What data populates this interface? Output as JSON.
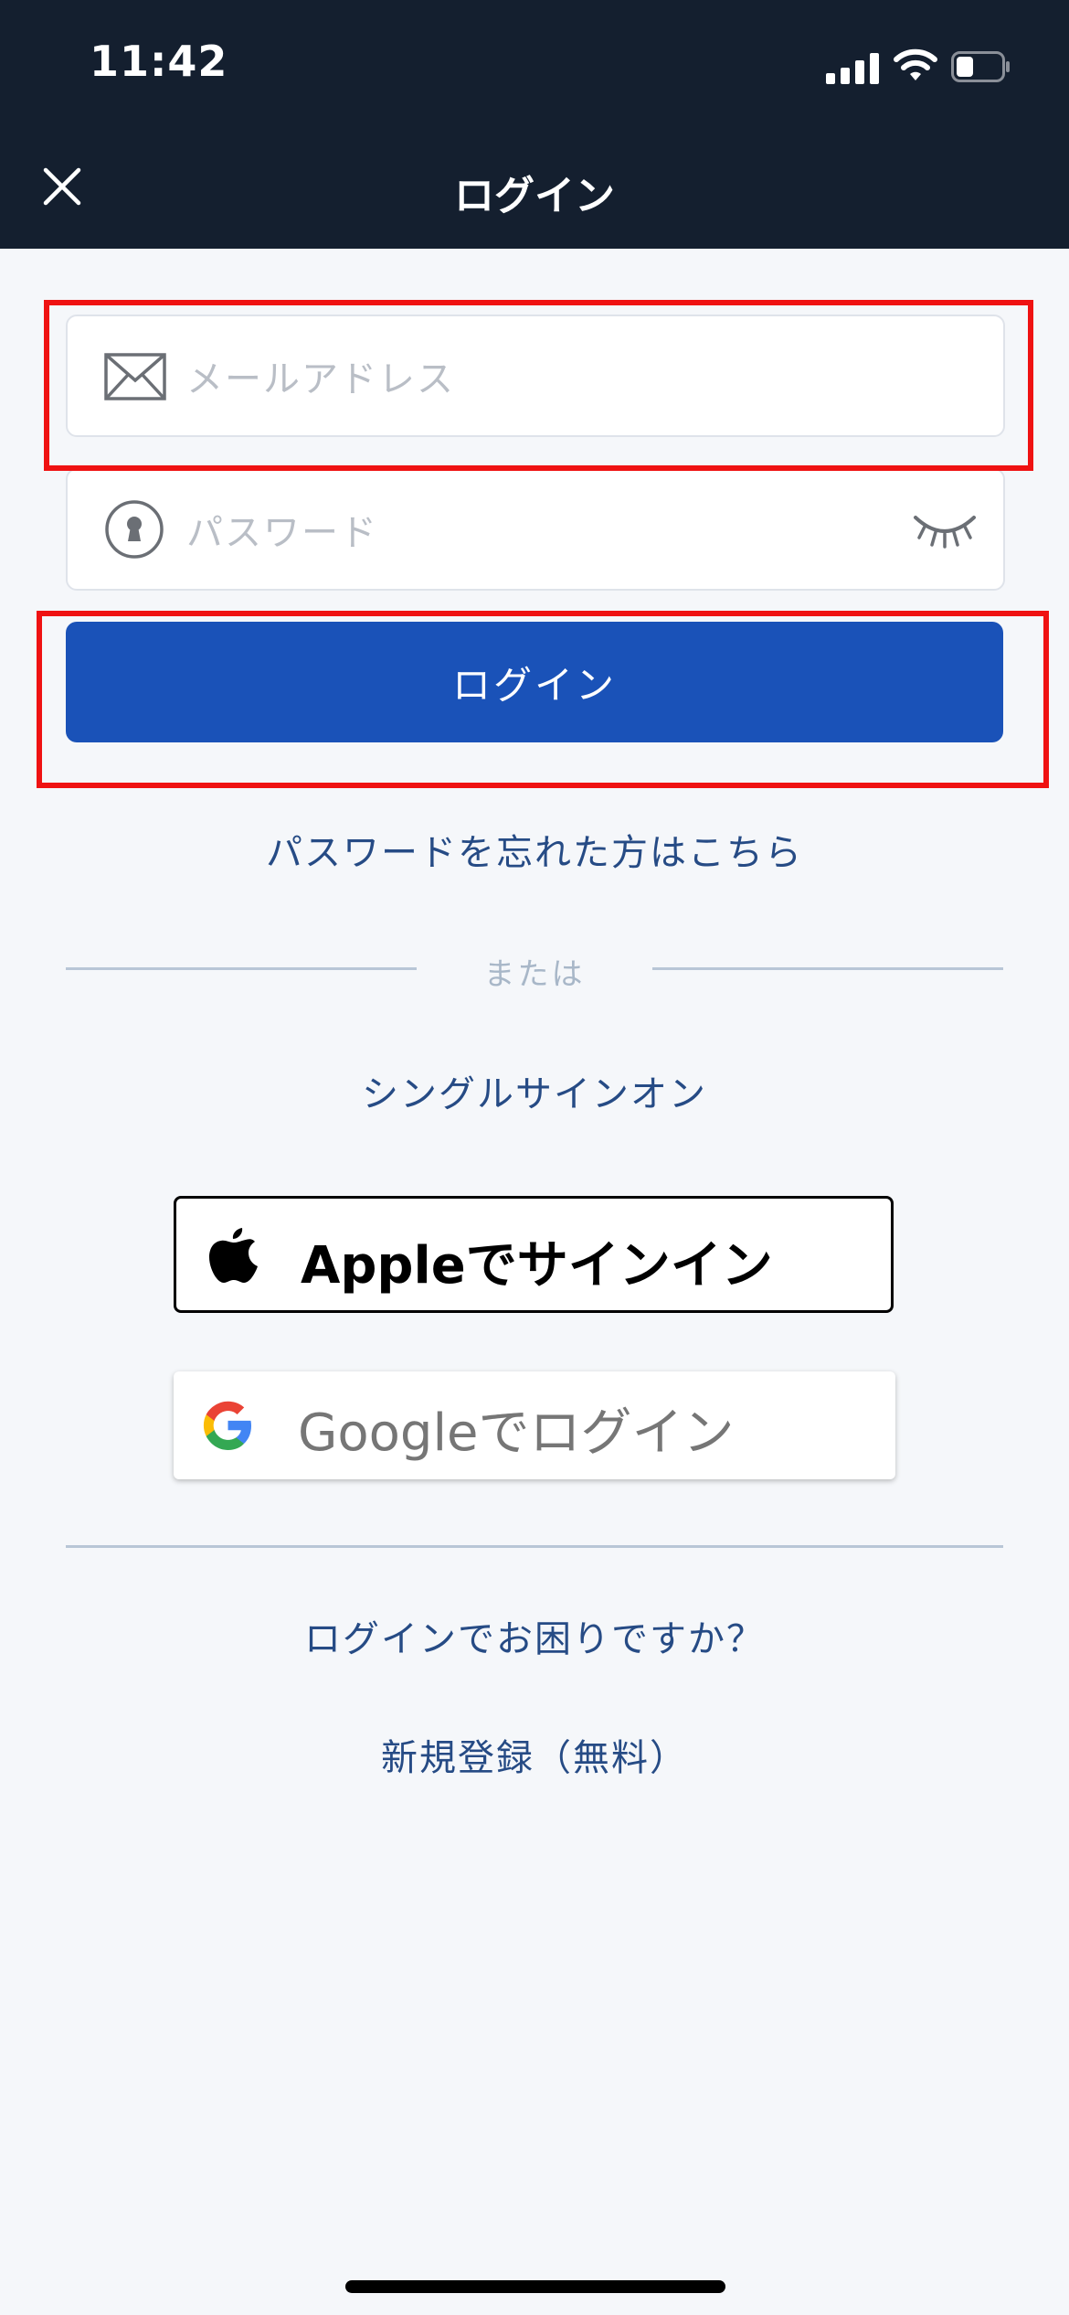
{
  "status_bar": {
    "time": "11:42"
  },
  "nav": {
    "title": "ログイン",
    "close_icon": "close-icon"
  },
  "form": {
    "email_placeholder": "メールアドレス",
    "password_placeholder": "パスワード",
    "login_label": "ログイン"
  },
  "links": {
    "forgot_password": "パスワードを忘れた方はこちら",
    "or": "または",
    "sso": "シングルサインオン",
    "trouble": "ログインでお困りですか？",
    "register": "新規登録（無料）"
  },
  "apple": {
    "label": "Appleでサインイン"
  },
  "google": {
    "label_brand": "Google",
    "label_rest": "でログイン"
  },
  "colors": {
    "header_bg": "#141f2f",
    "primary": "#1a52b8",
    "link": "#264b85",
    "highlight": "#ef1212"
  }
}
